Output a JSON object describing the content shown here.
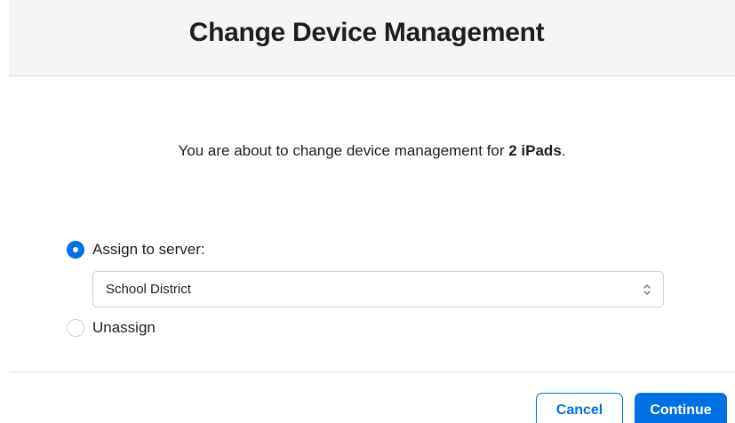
{
  "dialog": {
    "title": "Change Device Management",
    "message_prefix": "You are about to change device management for ",
    "message_count": "2 iPads",
    "message_suffix": "."
  },
  "options": {
    "assign_label": "Assign to server:",
    "assign_selected": true,
    "server_select": {
      "value": "School District",
      "icon": "chevron-up-down-icon"
    },
    "unassign_label": "Unassign",
    "unassign_selected": false
  },
  "buttons": {
    "cancel_label": "Cancel",
    "continue_label": "Continue"
  },
  "colors": {
    "accent": "#0071e3",
    "header_bg": "#f5f5f7",
    "text": "#1d1d1f",
    "border": "#d2d2d7"
  }
}
